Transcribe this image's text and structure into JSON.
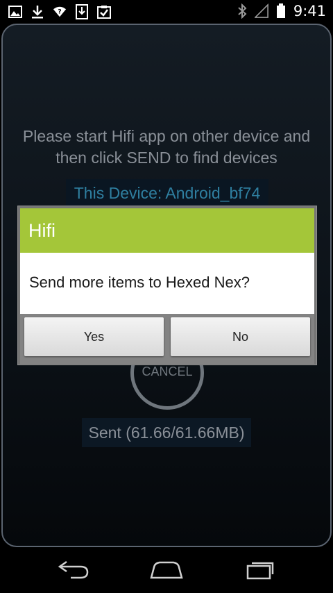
{
  "status_bar": {
    "time": "9:41",
    "left_icons": [
      "image-icon",
      "download-icon",
      "wifi-help-icon",
      "sd-download-icon",
      "clipboard-check-icon"
    ],
    "right_icons": [
      "bluetooth-icon",
      "signal-icon",
      "battery-icon"
    ]
  },
  "app": {
    "instruction_line1": "Please start Hifi app on other device and",
    "instruction_line2": "then click SEND to find devices",
    "device_label": "This Device: Android_bf74",
    "cancel_label": "CANCEL",
    "sent_status": "Sent (61.66/61.66MB)"
  },
  "dialog": {
    "title": "Hifi",
    "message": "Send more items to Hexed Nex?",
    "yes_label": "Yes",
    "no_label": "No"
  },
  "nav": {
    "icons": [
      "back-icon",
      "home-icon",
      "recents-icon"
    ]
  },
  "colors": {
    "dialog_title_bg": "#a4c639",
    "device_label_text": "#2f7fa0"
  }
}
